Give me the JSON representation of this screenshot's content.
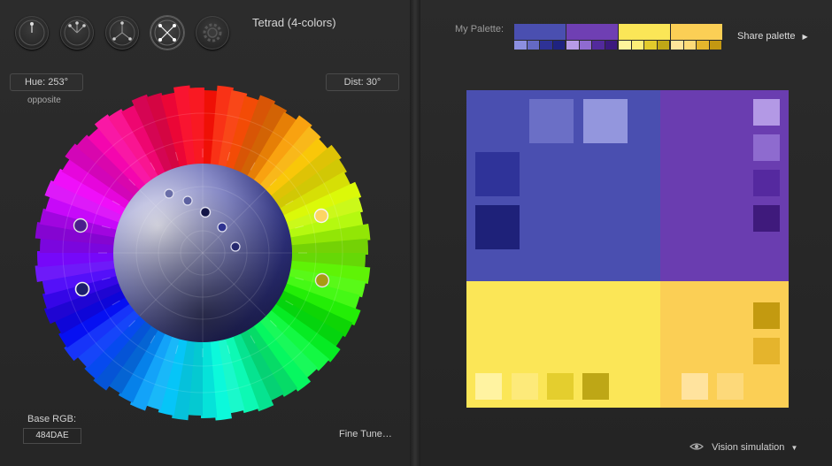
{
  "toolbar": {
    "modes": [
      {
        "name": "mono",
        "icon": "mono-mode-icon"
      },
      {
        "name": "adjacent",
        "icon": "adjacent-mode-icon"
      },
      {
        "name": "triad",
        "icon": "triad-mode-icon"
      },
      {
        "name": "tetrad",
        "icon": "tetrad-mode-icon",
        "active": true
      },
      {
        "name": "freestyle",
        "icon": "gear-mode-icon"
      }
    ],
    "scheme_title": "Tetrad (4-colors)"
  },
  "wheel": {
    "hue_label": "Hue: 253°",
    "dist_label": "Dist: 30°",
    "mode_sub": "opposite",
    "base_rgb_label": "Base RGB:",
    "base_rgb_value": "484DAE",
    "fine_tune": "Fine Tune…"
  },
  "palette": {
    "label": "My Palette:",
    "share": "Share palette",
    "share_icon": "chevron-right-icon",
    "colors": [
      {
        "main": "#4a4fb0",
        "subs": [
          "#8c8fe0",
          "#6469c4",
          "#2e3296",
          "#1f2380"
        ]
      },
      {
        "main": "#6f3fb3",
        "subs": [
          "#b79be6",
          "#8f6bd0",
          "#522a9c",
          "#3c1a7e"
        ]
      },
      {
        "main": "#fbe657",
        "subs": [
          "#fff59b",
          "#fdee78",
          "#e2cb2c",
          "#bfa716"
        ]
      },
      {
        "main": "#fbcf55",
        "subs": [
          "#ffe49a",
          "#fdda78",
          "#e5b62c",
          "#c49812"
        ]
      }
    ]
  },
  "preview": {
    "q1": "#4a4fb0",
    "q2": "#6a3db0",
    "q3": "#fbe657",
    "q4": "#fbcf55",
    "q1_swatches": [
      "#6b6fc6",
      "#9396dd",
      "#2f3399",
      "#1e2179"
    ],
    "q2_swatches": [
      "#b399e5",
      "#8e6bcf",
      "#55299f",
      "#3f1a7c"
    ],
    "q3_swatches": [
      "#fff3a1",
      "#fdea7a",
      "#e4ce2e",
      "#bea716"
    ],
    "q4_swatches": [
      "#c39a10",
      "#e5b42c",
      "#ffe39e",
      "#fdd97a"
    ]
  },
  "vision": {
    "label": "Vision simulation",
    "icon": "eye-icon",
    "arrow": "caret-down-icon"
  }
}
